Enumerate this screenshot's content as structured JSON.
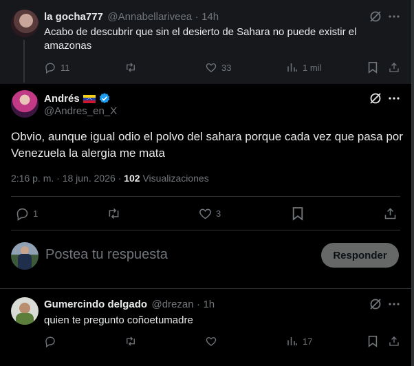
{
  "parent_tweet": {
    "display_name": "la gocha777",
    "handle": "@Annabellariveea",
    "sep": "·",
    "time": "14h",
    "text": "Acabo de descubrir que sin el desierto de Sahara no puede existir el amazonas",
    "replies": "11",
    "retweets": "",
    "likes": "33",
    "views": "1 mil"
  },
  "main_tweet": {
    "display_name": "Andrés",
    "flag_emoji": "🇻🇪",
    "handle": "@Andres_en_X",
    "text": "Obvio, aunque igual odio el polvo del sahara porque cada vez que pasa por Venezuela la alergia me mata",
    "timestamp": "2:16 p. m. · 18 jun. 2026 · ",
    "views_count": "102",
    "views_label": " Visualizaciones",
    "replies": "1",
    "retweets": "",
    "likes": "3"
  },
  "compose": {
    "placeholder": "Postea tu respuesta",
    "button_label": "Responder"
  },
  "reply_tweet": {
    "display_name": "Gumercindo delgado",
    "handle": "@drezan",
    "sep": "·",
    "time": "1h",
    "text": "quien te pregunto coñoetumadre",
    "replies": "",
    "retweets": "",
    "likes": "",
    "views": "17"
  },
  "colors": {
    "background": "#000000",
    "card": "#16181c",
    "text": "#e7e9ea",
    "muted": "#71767b",
    "verified": "#1d9bf0",
    "divider": "#2f3336"
  },
  "icons": [
    "grok-icon",
    "more-icon",
    "reply-icon",
    "retweet-icon",
    "like-icon",
    "views-icon",
    "bookmark-icon",
    "share-icon",
    "verified-badge-icon"
  ]
}
